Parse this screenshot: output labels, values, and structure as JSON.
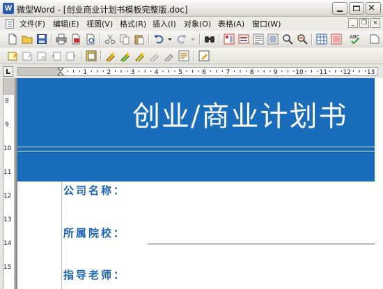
{
  "window": {
    "title": "微型Word - [创业商业计划书模板完整版.doc]",
    "app_icon_letter": "W",
    "close_glyph": "×"
  },
  "menu": {
    "items": [
      "文件(F)",
      "编辑(E)",
      "视图(V)",
      "格式(R)",
      "插入(I)",
      "对象(O)",
      "表格(A)",
      "窗口(W)"
    ],
    "mdi": [
      "_",
      "❐",
      "×"
    ]
  },
  "toolbar1": {
    "icons": [
      "new-doc-icon",
      "open-folder-icon",
      "save-icon",
      "print-icon",
      "pdf-export-icon",
      "print-preview-icon",
      "cut-icon",
      "copy-icon",
      "paste-icon",
      "undo-icon",
      "redo-icon",
      "find-icon",
      "page-layout-icon",
      "page-view-icon",
      "outline-view-icon",
      "full-screen-icon",
      "zoom-icon",
      "zoom-out-icon",
      "insert-table-icon",
      "insert-image-icon",
      "spell-check-icon",
      "close-doc-icon"
    ]
  },
  "toolbar2": {
    "icons": [
      "add-note-icon",
      "edit-note-icon",
      "delete-note-icon",
      "prev-note-icon",
      "next-note-icon",
      "highlight-icon",
      "mark-icon",
      "mark-accept-icon",
      "mark-reject-icon",
      "mark-clear-icon",
      "review-icon",
      "track-changes-icon"
    ]
  },
  "ruler": {
    "numbers": [
      "1",
      "2",
      "3",
      "4",
      "5",
      "6",
      "7",
      "8",
      "9",
      "10",
      "11",
      "12",
      "13"
    ]
  },
  "vruler": {
    "numbers": [
      "8",
      "9",
      "10",
      "11",
      "12",
      "13",
      "14",
      "15"
    ]
  },
  "document": {
    "title": "创业/商业计划书",
    "fields": [
      "公司名称：",
      "所属院校：",
      "指导老师："
    ]
  },
  "colors": {
    "banner": "#1a6dbb",
    "field_label": "#1a64b4"
  }
}
